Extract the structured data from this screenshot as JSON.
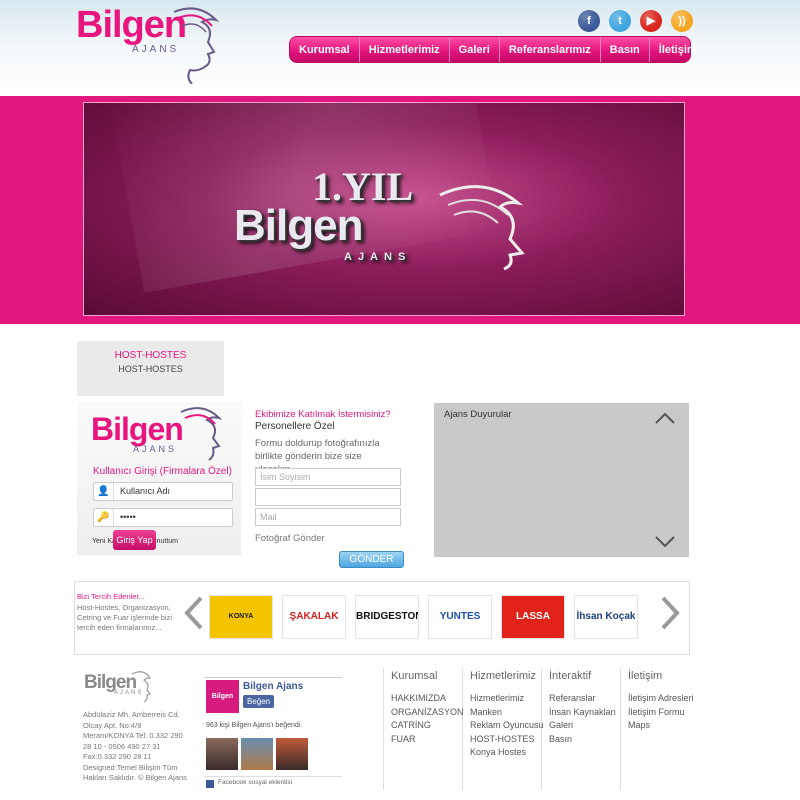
{
  "brand": {
    "logo_text": "Bilgen",
    "logo_sub": "AJANS"
  },
  "social": [
    {
      "name": "facebook-icon",
      "glyph": "f",
      "color": "#3b5998"
    },
    {
      "name": "twitter-icon",
      "glyph": "t",
      "color": "#3fa6e0"
    },
    {
      "name": "youtube-icon",
      "glyph": "▶",
      "color": "#d9261c"
    },
    {
      "name": "rss-icon",
      "glyph": "))",
      "color": "#f5a623"
    }
  ],
  "nav": [
    "Kurumsal",
    "Hizmetlerimiz",
    "Galeri",
    "Referanslarımız",
    "Basın",
    "İletişim"
  ],
  "banner": {
    "line1": "1.YIL",
    "line2": "Bilgen",
    "line3": "AJANS"
  },
  "host": {
    "title": "HOST-HOSTES",
    "subtitle": "HOST-HOSTES"
  },
  "login": {
    "heading": "Kullanıcı Girişi (Firmalara Özel)",
    "username_value": "Kullanıcı Adı",
    "password_value": "•••••",
    "links": "Yeni Kayıt | Şifremi unuttum",
    "button": "Giriş Yap"
  },
  "join": {
    "title": "Ekibimize Katılmak İstermisiniz?",
    "subtitle": "Personellere Özel",
    "desc": "Formu doldurup fotoğrafınızla birlikte gönderin bize size ulaşalım...",
    "name_placeholder": "İsim Soyisim",
    "mail_placeholder": "Mail",
    "photo_label": "Fotoğraf Gönder",
    "send_button": "GÖNDER"
  },
  "announcements": {
    "title": "Ajans Duyurular"
  },
  "references": {
    "title": "Bizi Tercih Edenler...",
    "desc": "Host-Hostes, Organizasyon, Cetring ve Fuar işlerinde bizi tercih eden firmalarımız...",
    "logos": [
      {
        "text": "KONYA BÜYÜKŞEHİR",
        "color": "#222",
        "bg": "#f5c400"
      },
      {
        "text": "ŞAKALAK",
        "color": "#d21e1e",
        "bg": "#fff"
      },
      {
        "text": "BRIDGESTONE",
        "color": "#111",
        "bg": "#fff"
      },
      {
        "text": "YUNTES",
        "color": "#1b4ea8",
        "bg": "#fff"
      },
      {
        "text": "LASSA",
        "color": "#fff",
        "bg": "#e2231a"
      },
      {
        "text": "İhsan Koçak",
        "color": "#1d3f7a",
        "bg": "#fff"
      }
    ]
  },
  "footer": {
    "address": "Abdülaziz Mh. Amberreis Cd. Olcay Apt. No:4/8 Meram/KONYA Tel: 0.332 290 28 10 - 0506 490 27 31 Fax:0.332 290 28 11 Designed:Temel Bilişim Tüm Hakları Saklıdır. © Bilgen Ajans",
    "fb_name": "Bilgen Ajans",
    "fb_like": "Beğen",
    "fb_count": "963 kişi Bilgen Ajans'ı beğendi.",
    "fb_plugin": "Facebook sosyal eklentisi",
    "columns": [
      {
        "title": "Kurumsal",
        "items": [
          "HAKKIMIZDA",
          "ORGANİZASYON",
          "CATRİNG",
          "FUAR"
        ]
      },
      {
        "title": "Hizmetlerimiz",
        "items": [
          "Hizmetlerimiz",
          "Manken",
          "Reklam Oyuncusu",
          "HOST-HOSTES",
          "Konya Hostes"
        ]
      },
      {
        "title": "İnteraktif",
        "items": [
          "Referanslar",
          "İnsan Kaynakları",
          "Galeri",
          "Basın"
        ]
      },
      {
        "title": "İletişim",
        "items": [
          "İletişim Adresleri",
          "İletişim Formu",
          "Maps"
        ]
      }
    ]
  },
  "colors": {
    "accent": "#e2187f",
    "nav_gradient_top": "#ff4fa6",
    "send_button": "#4ea7e0"
  }
}
